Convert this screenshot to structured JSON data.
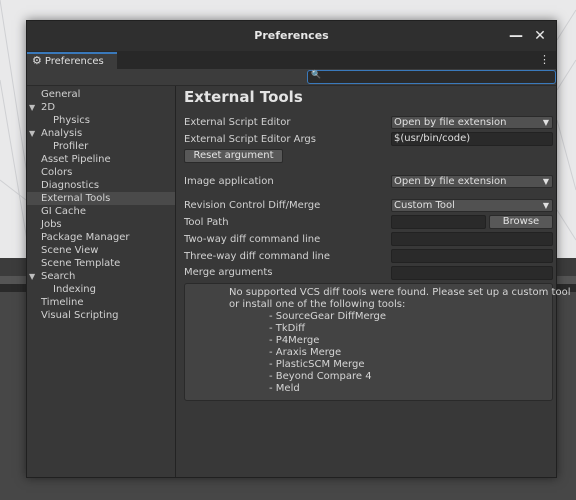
{
  "window": {
    "title": "Preferences",
    "minimize_label": "—",
    "close_label": "✕"
  },
  "tab": {
    "label": "Preferences",
    "icon": "gear-icon",
    "menu_label": "⋮"
  },
  "search": {
    "icon": "search-icon",
    "value": ""
  },
  "sidebar": {
    "items": [
      {
        "label": "General",
        "indent": 0,
        "arrow": "",
        "selected": false
      },
      {
        "label": "2D",
        "indent": 0,
        "arrow": "▼",
        "selected": false
      },
      {
        "label": "Physics",
        "indent": 2,
        "arrow": "",
        "selected": false
      },
      {
        "label": "Analysis",
        "indent": 0,
        "arrow": "▼",
        "selected": false
      },
      {
        "label": "Profiler",
        "indent": 2,
        "arrow": "",
        "selected": false
      },
      {
        "label": "Asset Pipeline",
        "indent": 0,
        "arrow": "",
        "selected": false
      },
      {
        "label": "Colors",
        "indent": 0,
        "arrow": "",
        "selected": false
      },
      {
        "label": "Diagnostics",
        "indent": 0,
        "arrow": "",
        "selected": false
      },
      {
        "label": "External Tools",
        "indent": 0,
        "arrow": "",
        "selected": true
      },
      {
        "label": "GI Cache",
        "indent": 0,
        "arrow": "",
        "selected": false
      },
      {
        "label": "Jobs",
        "indent": 0,
        "arrow": "",
        "selected": false
      },
      {
        "label": "Package Manager",
        "indent": 0,
        "arrow": "",
        "selected": false
      },
      {
        "label": "Scene View",
        "indent": 0,
        "arrow": "",
        "selected": false
      },
      {
        "label": "Scene Template",
        "indent": 0,
        "arrow": "",
        "selected": false
      },
      {
        "label": "Search",
        "indent": 0,
        "arrow": "▼",
        "selected": false
      },
      {
        "label": "Indexing",
        "indent": 2,
        "arrow": "",
        "selected": false
      },
      {
        "label": "Timeline",
        "indent": 0,
        "arrow": "",
        "selected": false
      },
      {
        "label": "Visual Scripting",
        "indent": 0,
        "arrow": "",
        "selected": false
      }
    ]
  },
  "main": {
    "title": "External Tools",
    "script_editor": {
      "label": "External Script Editor",
      "value": "Open by file extension"
    },
    "script_editor_args": {
      "label": "External Script Editor Args",
      "value": "$(usr/bin/code)"
    },
    "reset_button": "Reset argument",
    "image_app": {
      "label": "Image application",
      "value": "Open by file extension"
    },
    "revision_control": {
      "label": "Revision Control Diff/Merge",
      "value": "Custom Tool"
    },
    "tool_path": {
      "label": "Tool Path",
      "value": "",
      "browse_label": "Browse"
    },
    "two_way": {
      "label": "Two-way diff command line",
      "value": ""
    },
    "three_way": {
      "label": "Three-way diff command line",
      "value": ""
    },
    "merge_args": {
      "label": "Merge arguments",
      "value": ""
    },
    "help": {
      "line1": "No supported VCS diff tools were found. Please set up a custom tool",
      "line2": "or install one of the following tools:",
      "tools": [
        "- SourceGear DiffMerge",
        "- TkDiff",
        "- P4Merge",
        "- Araxis Merge",
        "- PlasticSCM Merge",
        "- Beyond Compare 4",
        "- Meld"
      ]
    }
  },
  "colors": {
    "accent": "#3a79bb",
    "window_bg": "#383838",
    "selection": "#4a4a4a"
  }
}
